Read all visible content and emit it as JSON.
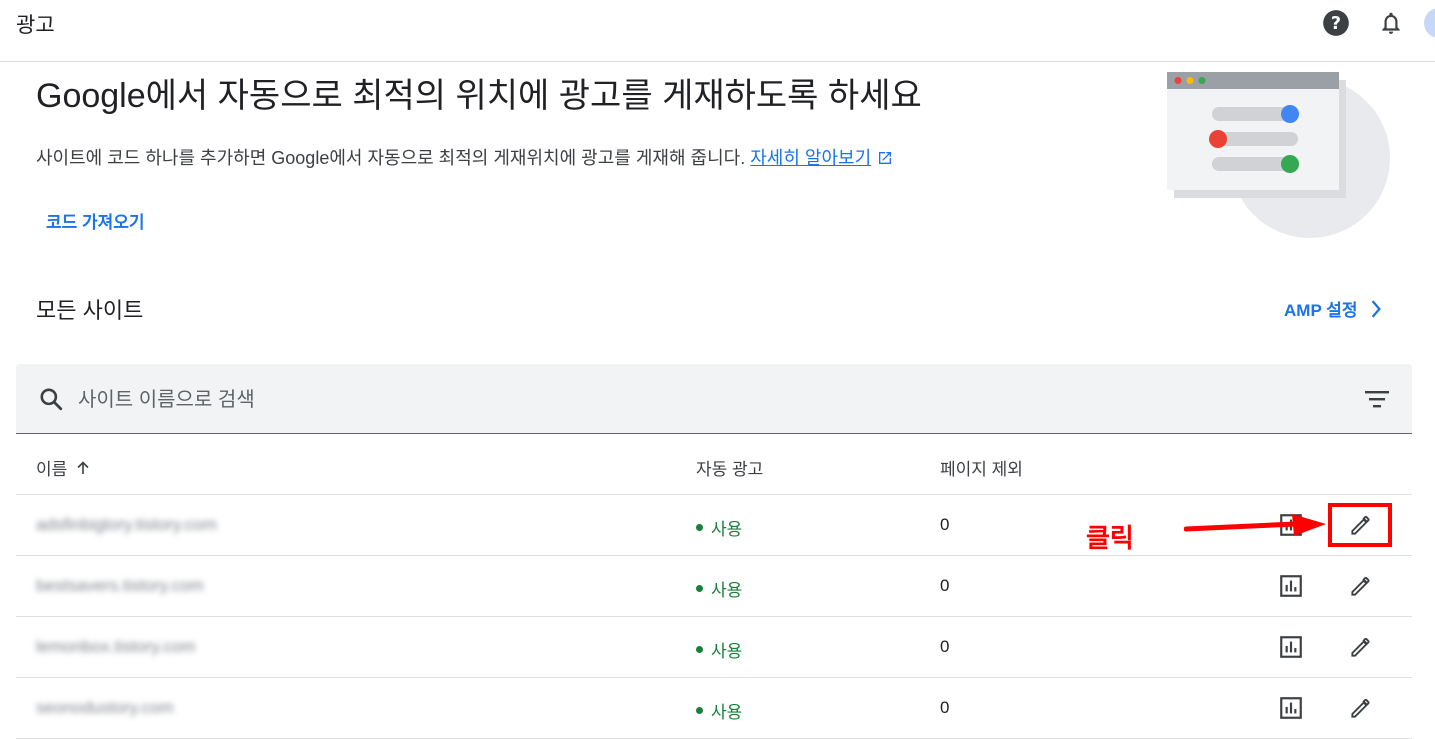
{
  "topbar": {
    "title": "광고",
    "icons": [
      "help-icon",
      "bell-icon",
      "avatar"
    ]
  },
  "hero": {
    "headline": "Google에서 자동으로 최적의 위치에 광고를 게재하도록 하세요",
    "description": "사이트에 코드 하나를 추가하면 Google에서 자동으로 최적의 게재위치에 광고를 게재해 줍니다.",
    "learn_more": "자세히 알아보기",
    "get_code_button": "코드 가져오기"
  },
  "section": {
    "title": "모든 사이트",
    "amp_settings": "AMP 설정"
  },
  "search": {
    "placeholder": "사이트 이름으로 검색"
  },
  "table": {
    "columns": [
      "이름",
      "자동 광고",
      "페이지 제외"
    ],
    "rows": [
      {
        "name": "adsfinbigtory.tistory.com",
        "auto_ads": "사용",
        "excluded_pages": "0"
      },
      {
        "name": "bestsavers.tistory.com",
        "auto_ads": "사용",
        "excluded_pages": "0"
      },
      {
        "name": "lemonbox.tistory.com",
        "auto_ads": "사용",
        "excluded_pages": "0"
      },
      {
        "name": "seonodustory.com",
        "auto_ads": "사용",
        "excluded_pages": "0"
      }
    ]
  },
  "annotation": {
    "label": "클릭",
    "color": "#ff0000"
  },
  "colors": {
    "accent": "#1a73e8",
    "status_on": "#188038"
  }
}
